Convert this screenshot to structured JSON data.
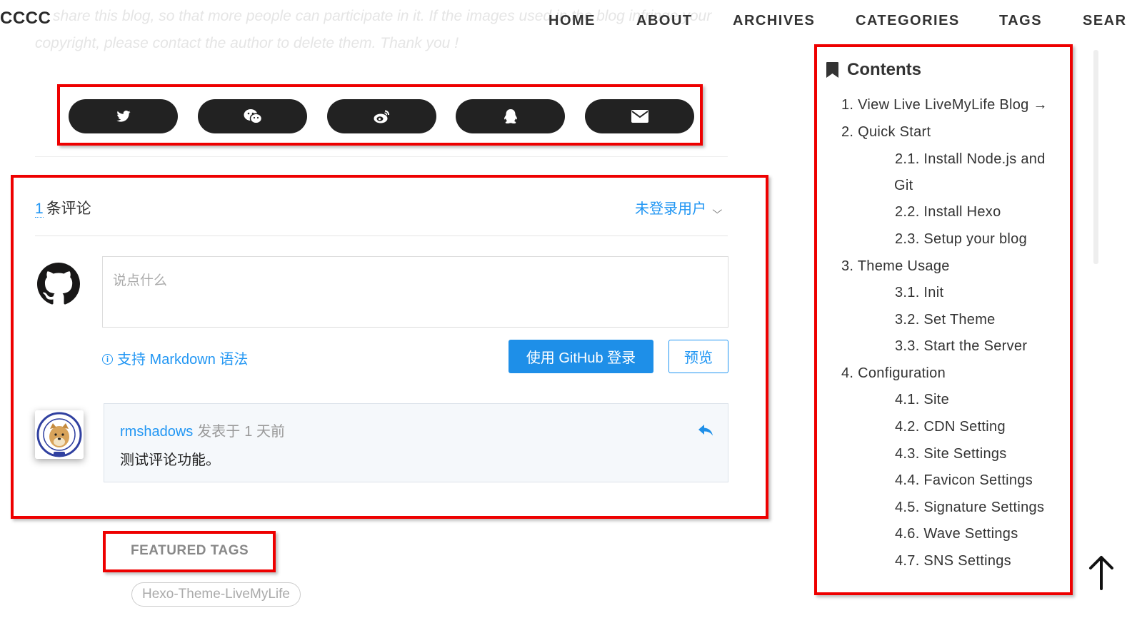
{
  "header": {
    "brand": "CCCC",
    "nav": [
      "HOME",
      "ABOUT",
      "ARCHIVES",
      "CATEGORIES",
      "TAGS",
      "SEAR"
    ]
  },
  "copyright": {
    "line1": "share this blog, so that more people can participate in it. If the images used in the blog infringe your",
    "line2": "copyright, please contact the author to delete them. Thank you !"
  },
  "share": {
    "icons": [
      "twitter-icon",
      "wechat-icon",
      "weibo-icon",
      "qq-icon",
      "email-icon"
    ]
  },
  "comments": {
    "count": "1",
    "count_label": "条评论",
    "login_user": "未登录用户",
    "placeholder": "说点什么",
    "markdown_tip": "支持 Markdown 语法",
    "github_login": "使用 GitHub 登录",
    "preview": "预览",
    "items": [
      {
        "author": "rmshadows",
        "posted_label": "发表于",
        "time": "1 天前",
        "text": "测试评论功能。"
      }
    ]
  },
  "featured": {
    "title": "FEATURED TAGS",
    "tags": [
      "Hexo-Theme-LiveMyLife"
    ]
  },
  "toc": {
    "title": "Contents",
    "items": [
      {
        "level": 1,
        "text": "1. View Live LiveMyLife Blog →"
      },
      {
        "level": 1,
        "text": "2. Quick Start"
      },
      {
        "level": 2,
        "text": "2.1. Install Node.js and",
        "cont": "Git"
      },
      {
        "level": 2,
        "text": "2.2. Install Hexo"
      },
      {
        "level": 2,
        "text": "2.3. Setup your blog"
      },
      {
        "level": 1,
        "text": "3. Theme Usage"
      },
      {
        "level": 2,
        "text": "3.1. Init"
      },
      {
        "level": 2,
        "text": "3.2. Set Theme"
      },
      {
        "level": 2,
        "text": "3.3. Start the Server"
      },
      {
        "level": 1,
        "text": "4. Configuration"
      },
      {
        "level": 2,
        "text": "4.1. Site"
      },
      {
        "level": 2,
        "text": "4.2. CDN Setting"
      },
      {
        "level": 2,
        "text": "4.3. Site Settings"
      },
      {
        "level": 2,
        "text": "4.4. Favicon Settings"
      },
      {
        "level": 2,
        "text": "4.5. Signature Settings"
      },
      {
        "level": 2,
        "text": "4.6. Wave Settings"
      },
      {
        "level": 2,
        "text": "4.7. SNS Settings"
      }
    ]
  },
  "colors": {
    "highlight_border": "#ee0000",
    "link_blue": "#2196f3",
    "button_blue": "#1e8fe8",
    "share_button": "#222222"
  }
}
